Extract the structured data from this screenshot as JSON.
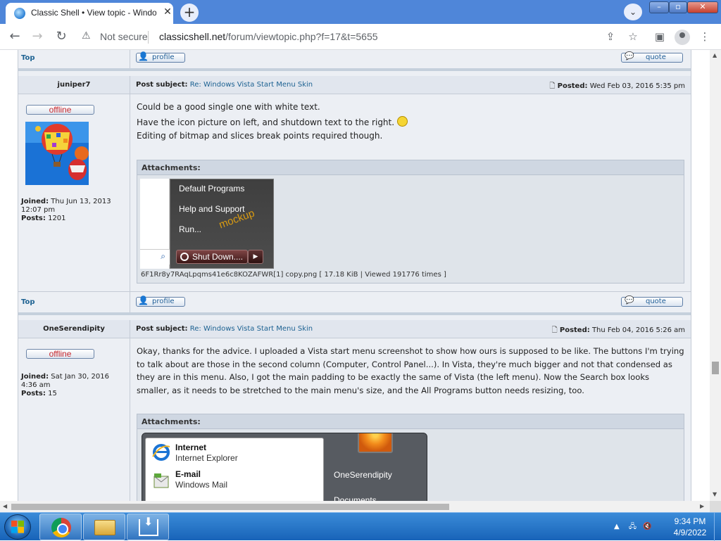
{
  "browser": {
    "tab_title": "Classic Shell • View topic - Windo",
    "tab_close": "✕",
    "new_tab": "+",
    "not_secure": "Not secure",
    "url_host": "classicshell.net",
    "url_path": "/forum/viewtopic.php?f=17&t=5655"
  },
  "post_prev": {
    "top": "Top",
    "profile": "profile",
    "quote": "quote"
  },
  "post1": {
    "author": "juniper7",
    "subject_label": "Post subject:",
    "subject": "Re: Windows Vista Start Menu Skin",
    "posted_label": "Posted:",
    "posted": "Wed Feb 03, 2016 5:35 pm",
    "status": "offline",
    "joined_label": "Joined:",
    "joined": "Thu Jun 13, 2013 12:07 pm",
    "posts_label": "Posts:",
    "posts": "1201",
    "line1": "Could be a good single one with white text.",
    "line2": "Have the icon picture on left, and shutdown text to the right.",
    "line3": "Editing of bitmap and slices break points required though.",
    "attachments_label": "Attachments:",
    "menu_items": [
      "Default Programs",
      "Help and Support",
      "Run..."
    ],
    "mockup": "mockup",
    "shutdown": "Shut Down....",
    "attachment_caption": "6F1Rr8y7RAqLpqms41e6c8KOZAFWR[1] copy.png [ 17.18 KiB | Viewed 191776 times ]",
    "top": "Top",
    "profile": "profile",
    "quote": "quote"
  },
  "post2": {
    "author": "OneSerendipity",
    "subject_label": "Post subject:",
    "subject": "Re: Windows Vista Start Menu Skin",
    "posted_label": "Posted:",
    "posted": "Thu Feb 04, 2016 5:26 am",
    "status": "offline",
    "joined_label": "Joined:",
    "joined": "Sat Jan 30, 2016 4:36 am",
    "posts_label": "Posts:",
    "posts": "15",
    "body_lines": [
      "Okay, thanks for the advice. I uploaded a Vista start menu screenshot to show how ours is supposed to be like. The buttons I'm trying",
      "to talk about are those in the second column (Computer, Control Panel...). In Vista, they're much bigger and not that condensed as",
      "they are in this menu. Also, I got the main padding to be exactly the same of Vista (the left menu). Now the Search box looks",
      "smaller, as it needs to be stretched to the main menu's size, and the All Programs button needs resizing, too."
    ],
    "attachments_label": "Attachments:",
    "vista_items": [
      {
        "title": "Internet",
        "sub": "Internet Explorer"
      },
      {
        "title": "E-mail",
        "sub": "Windows Mail"
      }
    ],
    "vista_user": "OneSerendipity",
    "vista_docs": "Documents"
  },
  "taskbar": {
    "time": "9:34 PM",
    "date": "4/9/2022"
  }
}
